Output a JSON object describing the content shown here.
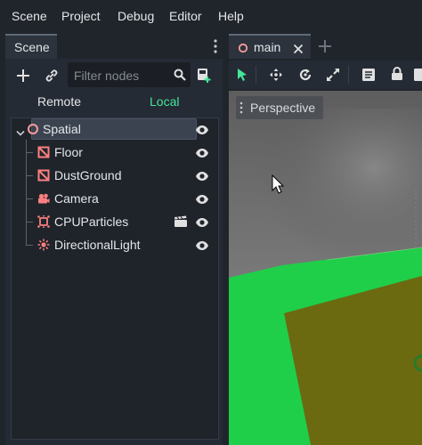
{
  "menubar": {
    "items": [
      "Scene",
      "Project",
      "Debug",
      "Editor",
      "Help"
    ]
  },
  "dock": {
    "tab_label": "Scene",
    "filter_placeholder": "Filter nodes",
    "remote_label": "Remote",
    "local_label": "Local",
    "nodes": [
      {
        "label": "Spatial",
        "icon": "spatial-icon",
        "selected": true
      },
      {
        "label": "Floor",
        "icon": "mesh-instance-icon"
      },
      {
        "label": "DustGround",
        "icon": "mesh-instance-icon"
      },
      {
        "label": "Camera",
        "icon": "camera-icon"
      },
      {
        "label": "CPUParticles",
        "icon": "particles-icon"
      },
      {
        "label": "DirectionalLight",
        "icon": "directional-light-icon"
      }
    ]
  },
  "main": {
    "tab_label": "main",
    "perspective_label": "Perspective"
  },
  "colors": {
    "accent_green": "#45e59a",
    "node_icon_red": "#fc7f7f",
    "spatial_icon": "#fc9c9c",
    "tool_green": "#45e59a"
  }
}
